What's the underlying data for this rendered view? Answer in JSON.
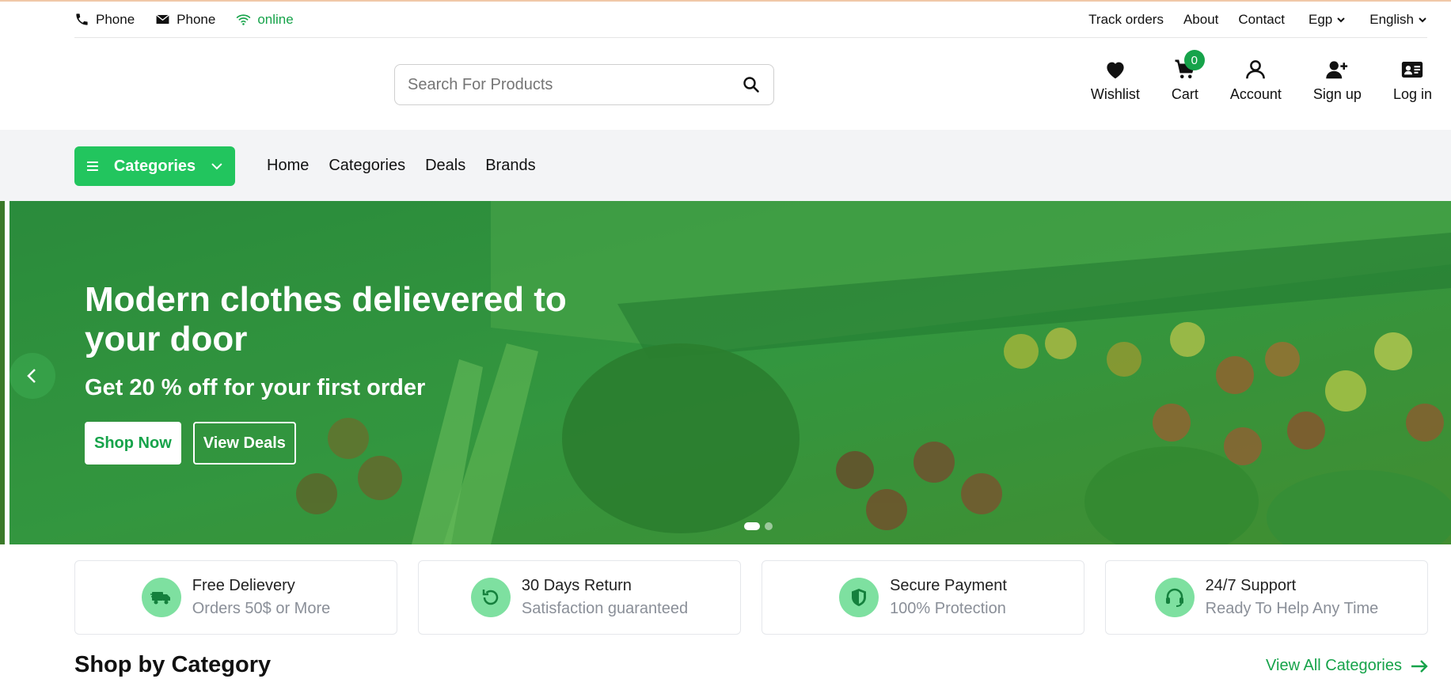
{
  "topbar": {
    "phone_label": "Phone",
    "email_label": "Phone",
    "status_label": "online",
    "links": [
      "Track orders",
      "About",
      "Contact"
    ],
    "currency": "Egp",
    "language": "English"
  },
  "search": {
    "placeholder": "Search For Products"
  },
  "actions": {
    "wishlist": "Wishlist",
    "cart": "Cart",
    "cart_count": "0",
    "account": "Account",
    "signup": "Sign up",
    "login": "Log in"
  },
  "nav": {
    "categories_button": "Categories",
    "links": [
      "Home",
      "Categories",
      "Deals",
      "Brands"
    ]
  },
  "hero": {
    "title": "Modern clothes delievered to your door",
    "subtitle": "Get 20 % off for your first order",
    "shop_now": "Shop Now",
    "view_deals": "View Deals"
  },
  "features": [
    {
      "icon": "truck-icon",
      "title": "Free Delievery",
      "subtitle": "Orders 50$ or More"
    },
    {
      "icon": "return-icon",
      "title": "30 Days Return",
      "subtitle": "Satisfaction guaranteed"
    },
    {
      "icon": "shield-icon",
      "title": "Secure Payment",
      "subtitle": "100% Protection"
    },
    {
      "icon": "headset-icon",
      "title": "24/7 Support",
      "subtitle": "Ready To Help Any Time"
    }
  ],
  "shop_by_category": {
    "title": "Shop by Category",
    "view_all": "View All Categories"
  },
  "colors": {
    "accent": "#16a34a",
    "button_green": "#22c55e",
    "icon_circle": "#7ee0a0",
    "nav_bg": "#f3f4f6"
  }
}
